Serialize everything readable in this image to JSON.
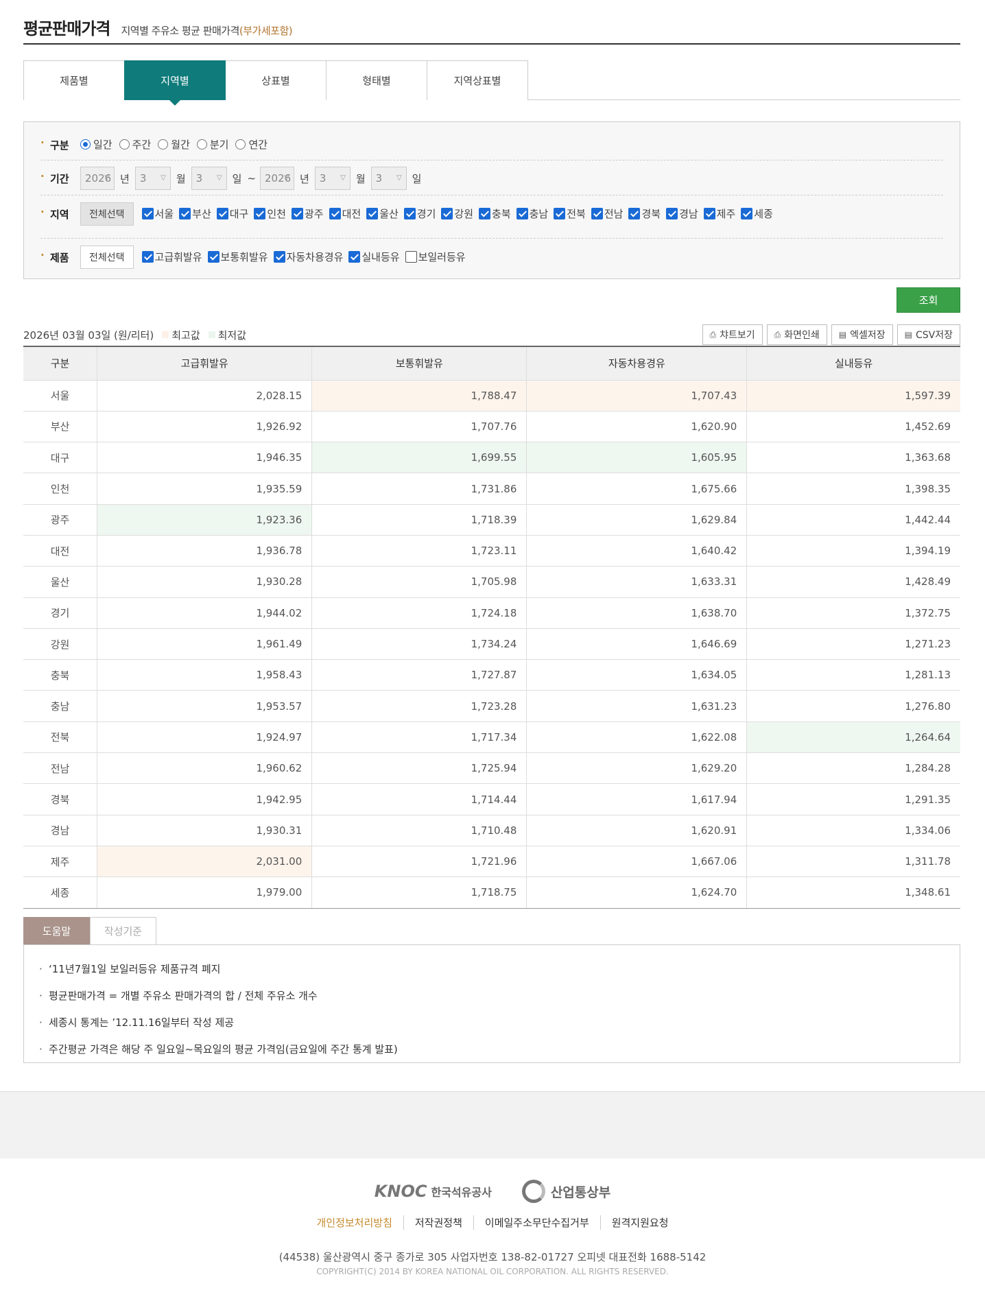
{
  "header": {
    "title": "평균판매가격",
    "subtitle": "지역별 주유소 평균 판매가격",
    "vat_note": "(부가세포함)"
  },
  "tabs": [
    {
      "label": "제품별",
      "active": false
    },
    {
      "label": "지역별",
      "active": true
    },
    {
      "label": "상표별",
      "active": false
    },
    {
      "label": "형태별",
      "active": false
    },
    {
      "label": "지역상표별",
      "active": false
    }
  ],
  "filter": {
    "division_label": "구분",
    "division_options": [
      {
        "label": "일간",
        "checked": true
      },
      {
        "label": "주간",
        "checked": false
      },
      {
        "label": "월간",
        "checked": false
      },
      {
        "label": "분기",
        "checked": false
      },
      {
        "label": "연간",
        "checked": false
      }
    ],
    "period_label": "기간",
    "period": {
      "from_year": "2026",
      "from_month": "3",
      "from_day": "3",
      "to_year": "2026",
      "to_month": "3",
      "to_day": "3",
      "year_unit": "년",
      "month_unit": "월",
      "day_unit": "일",
      "tilde": "~"
    },
    "region_label": "지역",
    "region_select_all": "전체선택",
    "regions": [
      {
        "label": "서울",
        "checked": true
      },
      {
        "label": "부산",
        "checked": true
      },
      {
        "label": "대구",
        "checked": true
      },
      {
        "label": "인천",
        "checked": true
      },
      {
        "label": "광주",
        "checked": true
      },
      {
        "label": "대전",
        "checked": true
      },
      {
        "label": "울산",
        "checked": true
      },
      {
        "label": "경기",
        "checked": true
      },
      {
        "label": "강원",
        "checked": true
      },
      {
        "label": "충북",
        "checked": true
      },
      {
        "label": "충남",
        "checked": true
      },
      {
        "label": "전북",
        "checked": true
      },
      {
        "label": "전남",
        "checked": true
      },
      {
        "label": "경북",
        "checked": true
      },
      {
        "label": "경남",
        "checked": true
      },
      {
        "label": "제주",
        "checked": true
      },
      {
        "label": "세종",
        "checked": true
      }
    ],
    "product_label": "제품",
    "product_select_all": "전체선택",
    "products": [
      {
        "label": "고급휘발유",
        "checked": true
      },
      {
        "label": "보통휘발유",
        "checked": true
      },
      {
        "label": "자동차용경유",
        "checked": true
      },
      {
        "label": "실내등유",
        "checked": true
      },
      {
        "label": "보일러등유",
        "checked": false
      }
    ]
  },
  "search_button": "조회",
  "info": {
    "date_unit": "2026년 03월 03일  (원/리터)",
    "legend_max": "최고값",
    "legend_min": "최저값",
    "color_max": "#fdf0e6",
    "color_min": "#eaf5ee"
  },
  "tools": [
    {
      "label": "챠트보기",
      "icon": "chart-print-icon"
    },
    {
      "label": "화면인쇄",
      "icon": "printer-icon"
    },
    {
      "label": "엑셀저장",
      "icon": "save-icon"
    },
    {
      "label": "CSV저장",
      "icon": "save-icon"
    }
  ],
  "table": {
    "headers": [
      "구분",
      "고급휘발유",
      "보통휘발유",
      "자동차용경유",
      "실내등유"
    ],
    "rows": [
      {
        "region": "서울",
        "values": [
          "2,028.15",
          "1,788.47",
          "1,707.43",
          "1,597.39"
        ],
        "marks": [
          "",
          "hi",
          "hi",
          "hi"
        ]
      },
      {
        "region": "부산",
        "values": [
          "1,926.92",
          "1,707.76",
          "1,620.90",
          "1,452.69"
        ],
        "marks": [
          "",
          "",
          "",
          ""
        ]
      },
      {
        "region": "대구",
        "values": [
          "1,946.35",
          "1,699.55",
          "1,605.95",
          "1,363.68"
        ],
        "marks": [
          "",
          "lo",
          "lo",
          ""
        ]
      },
      {
        "region": "인천",
        "values": [
          "1,935.59",
          "1,731.86",
          "1,675.66",
          "1,398.35"
        ],
        "marks": [
          "",
          "",
          "",
          ""
        ]
      },
      {
        "region": "광주",
        "values": [
          "1,923.36",
          "1,718.39",
          "1,629.84",
          "1,442.44"
        ],
        "marks": [
          "lo",
          "",
          "",
          ""
        ]
      },
      {
        "region": "대전",
        "values": [
          "1,936.78",
          "1,723.11",
          "1,640.42",
          "1,394.19"
        ],
        "marks": [
          "",
          "",
          "",
          ""
        ]
      },
      {
        "region": "울산",
        "values": [
          "1,930.28",
          "1,705.98",
          "1,633.31",
          "1,428.49"
        ],
        "marks": [
          "",
          "",
          "",
          ""
        ]
      },
      {
        "region": "경기",
        "values": [
          "1,944.02",
          "1,724.18",
          "1,638.70",
          "1,372.75"
        ],
        "marks": [
          "",
          "",
          "",
          ""
        ]
      },
      {
        "region": "강원",
        "values": [
          "1,961.49",
          "1,734.24",
          "1,646.69",
          "1,271.23"
        ],
        "marks": [
          "",
          "",
          "",
          ""
        ]
      },
      {
        "region": "충북",
        "values": [
          "1,958.43",
          "1,727.87",
          "1,634.05",
          "1,281.13"
        ],
        "marks": [
          "",
          "",
          "",
          ""
        ]
      },
      {
        "region": "충남",
        "values": [
          "1,953.57",
          "1,723.28",
          "1,631.23",
          "1,276.80"
        ],
        "marks": [
          "",
          "",
          "",
          ""
        ]
      },
      {
        "region": "전북",
        "values": [
          "1,924.97",
          "1,717.34",
          "1,622.08",
          "1,264.64"
        ],
        "marks": [
          "",
          "",
          "",
          "lo"
        ]
      },
      {
        "region": "전남",
        "values": [
          "1,960.62",
          "1,725.94",
          "1,629.20",
          "1,284.28"
        ],
        "marks": [
          "",
          "",
          "",
          ""
        ]
      },
      {
        "region": "경북",
        "values": [
          "1,942.95",
          "1,714.44",
          "1,617.94",
          "1,291.35"
        ],
        "marks": [
          "",
          "",
          "",
          ""
        ]
      },
      {
        "region": "경남",
        "values": [
          "1,930.31",
          "1,710.48",
          "1,620.91",
          "1,334.06"
        ],
        "marks": [
          "",
          "",
          "",
          ""
        ]
      },
      {
        "region": "제주",
        "values": [
          "2,031.00",
          "1,721.96",
          "1,667.06",
          "1,311.78"
        ],
        "marks": [
          "hi",
          "",
          "",
          ""
        ]
      },
      {
        "region": "세종",
        "values": [
          "1,979.00",
          "1,718.75",
          "1,624.70",
          "1,348.61"
        ],
        "marks": [
          "",
          "",
          "",
          ""
        ]
      }
    ]
  },
  "help": {
    "tabs": [
      {
        "label": "도움말",
        "active": true
      },
      {
        "label": "작성기준",
        "active": false
      }
    ],
    "items": [
      "‘11년7월1일 보일러등유 제품규격 폐지",
      "평균판매가격 = 개별 주유소 판매가격의 합 / 전체 주유소 개수",
      "세종시 통계는 ’12.11.16일부터 작성 제공",
      "주간평균 가격은 해당 주 일요일~목요일의 평균 가격임(금요일에 주간 통계 발표)"
    ]
  },
  "footer": {
    "logo_knoc_mark": "KNOC",
    "logo_knoc_text": "한국석유공사",
    "logo_ministry": "산업통상부",
    "links": [
      "개인정보처리방침",
      "저작권정책",
      "이메일주소무단수집거부",
      "원격지원요청"
    ],
    "address": "(44538) 울산광역시 중구 종가로 305 사업자번호 138-82-01727    오피넷 대표전화 1688-5142",
    "copyright": "COPYRIGHT(C) 2014 BY KOREA NATIONAL OIL CORPORATION. ALL RIGHTS RESERVED."
  }
}
